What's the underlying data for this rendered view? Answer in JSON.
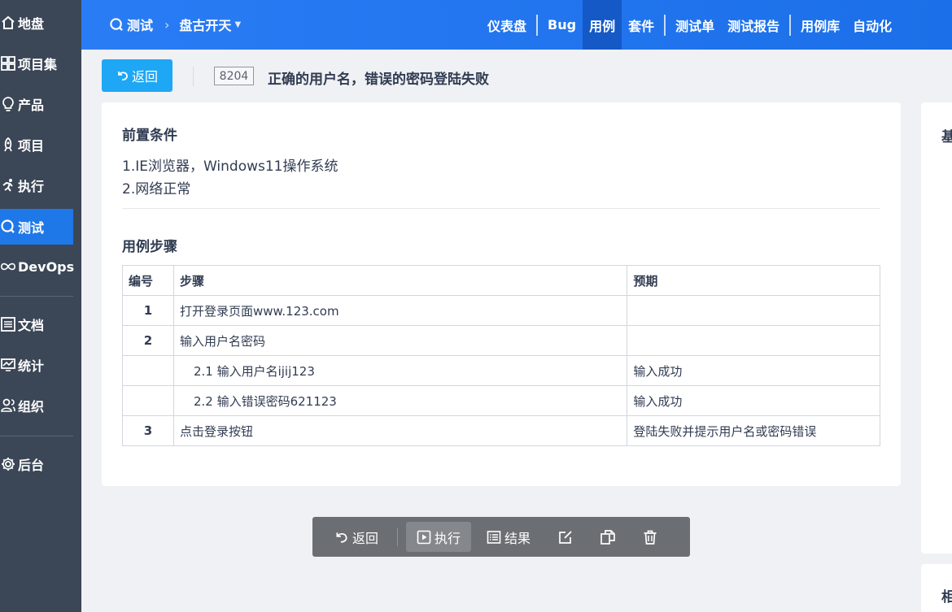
{
  "sidebar": {
    "items": [
      {
        "label": "地盘",
        "icon": "home-icon"
      },
      {
        "label": "项目集",
        "icon": "grid-icon"
      },
      {
        "label": "产品",
        "icon": "bulb-icon"
      },
      {
        "label": "项目",
        "icon": "rocket-icon"
      },
      {
        "label": "执行",
        "icon": "run-icon"
      },
      {
        "label": "测试",
        "icon": "magnifier-icon"
      },
      {
        "label": "DevOps",
        "icon": "infinity-icon"
      },
      {
        "label": "文档",
        "icon": "doc-icon"
      },
      {
        "label": "统计",
        "icon": "chart-icon"
      },
      {
        "label": "组织",
        "icon": "people-icon"
      },
      {
        "label": "后台",
        "icon": "gear-icon"
      }
    ],
    "active": "测试"
  },
  "header": {
    "crumb_root": "测试",
    "crumb_product": "盘古开天",
    "nav": [
      "仪表盘",
      "Bug",
      "用例",
      "套件",
      "测试单",
      "测试报告",
      "用例库",
      "自动化"
    ],
    "active_nav": "用例"
  },
  "case": {
    "back_label": "返回",
    "id": "8204",
    "title": "正确的用户名，错误的密码登陆失败"
  },
  "precondition": {
    "title": "前置条件",
    "lines": [
      "1.IE浏览器，Windows11操作系统",
      "2.网络正常"
    ]
  },
  "steps": {
    "title": "用例步骤",
    "headers": [
      "编号",
      "步骤",
      "预期"
    ],
    "rows": [
      {
        "num": "1",
        "step": "打开登录页面www.123.com",
        "expect": ""
      },
      {
        "num": "2",
        "step": "输入用户名密码",
        "expect": ""
      },
      {
        "num": "",
        "step": "2.1  输入用户名ijij123",
        "expect": "输入成功"
      },
      {
        "num": "",
        "step": "2.2  输入错误密码621123",
        "expect": "输入成功"
      },
      {
        "num": "3",
        "step": "点击登录按钮",
        "expect": "登陆失败并提示用户名或密码错误"
      }
    ]
  },
  "right_panel": {
    "title_partial": "基",
    "title2_partial": "相"
  },
  "toolbar": {
    "back": "返回",
    "run": "执行",
    "result": "结果"
  },
  "colors": {
    "accent": "#1e78e8",
    "sidebar": "#3b4656",
    "back_button": "#1ea7f5"
  }
}
